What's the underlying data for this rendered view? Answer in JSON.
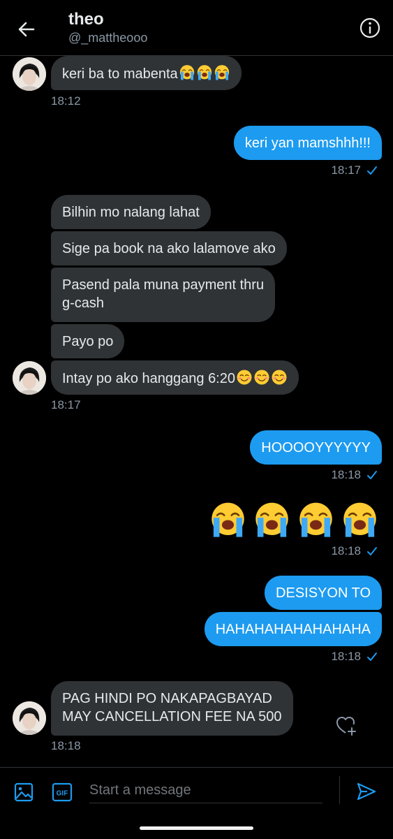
{
  "header": {
    "title": "theo",
    "handle": "@_mattheooo"
  },
  "messages": {
    "m1": {
      "text": "keri ba to mabenta",
      "time": "18:12"
    },
    "m2": {
      "text": "keri yan mamshhh!!!",
      "time": "18:17"
    },
    "m3": {
      "text": "Bilhin mo nalang lahat"
    },
    "m4": {
      "text": "Sige pa book na ako lalamove ako"
    },
    "m5": {
      "line1": "Pasend pala muna payment thru",
      "line2": "g-cash"
    },
    "m6": {
      "text": "Payo po"
    },
    "m7": {
      "text": "Intay po ako hanggang 6:20",
      "time": "18:17"
    },
    "m8": {
      "text": "HOOOOYYYYYY",
      "time": "18:18"
    },
    "m9": {
      "time": "18:18"
    },
    "m10": {
      "text": "DESISYON TO"
    },
    "m11": {
      "text": "HAHAHAHAHAHAHAHA",
      "time": "18:18"
    },
    "m12": {
      "line1": "PAG HINDI PO NAKAPAGBAYAD",
      "line2": "MAY CANCELLATION FEE NA 500",
      "time": "18:18"
    }
  },
  "composer": {
    "placeholder": "Start a message",
    "gif_label": "GIF"
  },
  "colors": {
    "accent": "#1d9bf0",
    "incoming_bubble": "#2f3336",
    "background": "#000000"
  },
  "icons": [
    "back-arrow-icon",
    "info-icon",
    "crying-face-emoji",
    "smiling-face-emoji",
    "heart-plus-icon",
    "image-icon",
    "gif-icon",
    "send-icon",
    "read-check-icon"
  ]
}
